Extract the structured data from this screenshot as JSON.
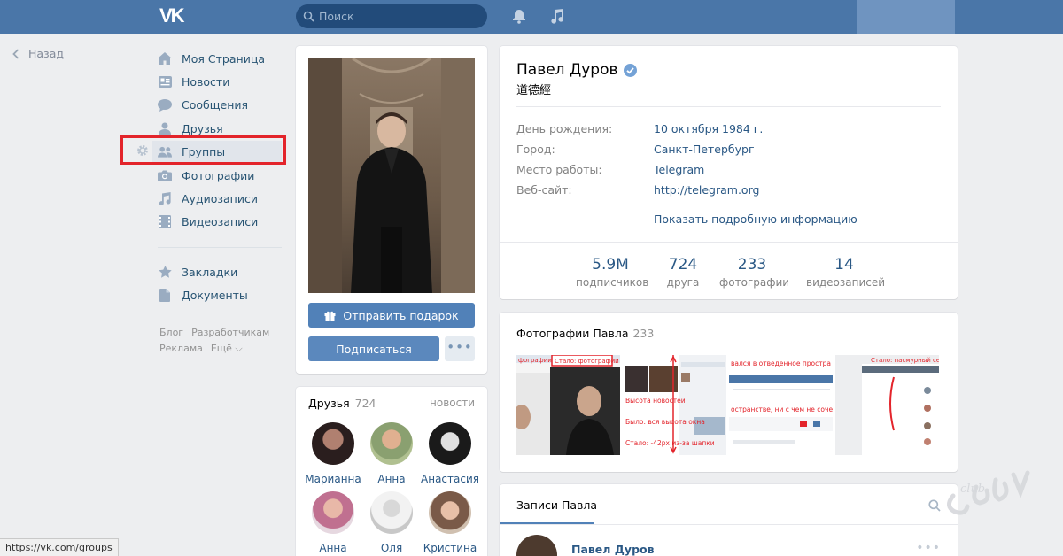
{
  "topbar": {
    "logo": "VK",
    "search_placeholder": "Поиск"
  },
  "back_label": "Назад",
  "nav": {
    "items": [
      {
        "label": "Моя Страница",
        "icon": "home-icon"
      },
      {
        "label": "Новости",
        "icon": "news-icon"
      },
      {
        "label": "Сообщения",
        "icon": "messages-icon"
      },
      {
        "label": "Друзья",
        "icon": "friends-icon"
      },
      {
        "label": "Группы",
        "icon": "groups-icon"
      },
      {
        "label": "Фотографии",
        "icon": "camera-icon"
      },
      {
        "label": "Аудиозаписи",
        "icon": "music-icon"
      },
      {
        "label": "Видеозаписи",
        "icon": "video-icon"
      }
    ],
    "extra": [
      {
        "label": "Закладки",
        "icon": "star-icon"
      },
      {
        "label": "Документы",
        "icon": "document-icon"
      }
    ],
    "active_index": 4
  },
  "footer": {
    "links_row1": [
      "Блог",
      "Разработчикам"
    ],
    "links_row2": [
      "Реклама",
      "Ещё ⌵"
    ]
  },
  "profile": {
    "gift_button": "Отправить подарок",
    "subscribe_button": "Подписаться",
    "more_button": "•••",
    "name": "Павел Дуров",
    "status": "道德經",
    "rows": [
      {
        "k": "День рождения:",
        "v": "10 октября 1984 г."
      },
      {
        "k": "Город:",
        "v": "Санкт-Петербург"
      },
      {
        "k": "Место работы:",
        "v": "Telegram"
      },
      {
        "k": "Веб-сайт:",
        "v": "http://telegram.org"
      }
    ],
    "more_info": "Показать подробную информацию",
    "counters": [
      {
        "num": "5.9M",
        "lab": "подписчиков"
      },
      {
        "num": "724",
        "lab": "друга"
      },
      {
        "num": "233",
        "lab": "фотографии"
      },
      {
        "num": "14",
        "lab": "видеозаписей"
      }
    ]
  },
  "friends": {
    "title": "Друзья",
    "count": "724",
    "news_link": "новости",
    "list": [
      "Марианна",
      "Анна",
      "Анастасия",
      "Анна",
      "Оля",
      "Кристина"
    ]
  },
  "photos": {
    "title": "Фотографии Павла",
    "count": "233",
    "thumb_texts": {
      "t1": "фографии",
      "t1b": "Стало: фотографии",
      "t2a": "Высота новостей",
      "t2b": "Было: вся высота окна",
      "t2c": "Стало: -42px из-за шапки",
      "t3": "вался в отведенное простра",
      "t3b": "остранстве, ни с чем не сочета",
      "t4": "Стало: пасмурный серый"
    }
  },
  "posts": {
    "tab": "Записи Павла",
    "author": "Павел Дуров",
    "dots": "•••"
  },
  "statusbar": "https://vk.com/groups"
}
